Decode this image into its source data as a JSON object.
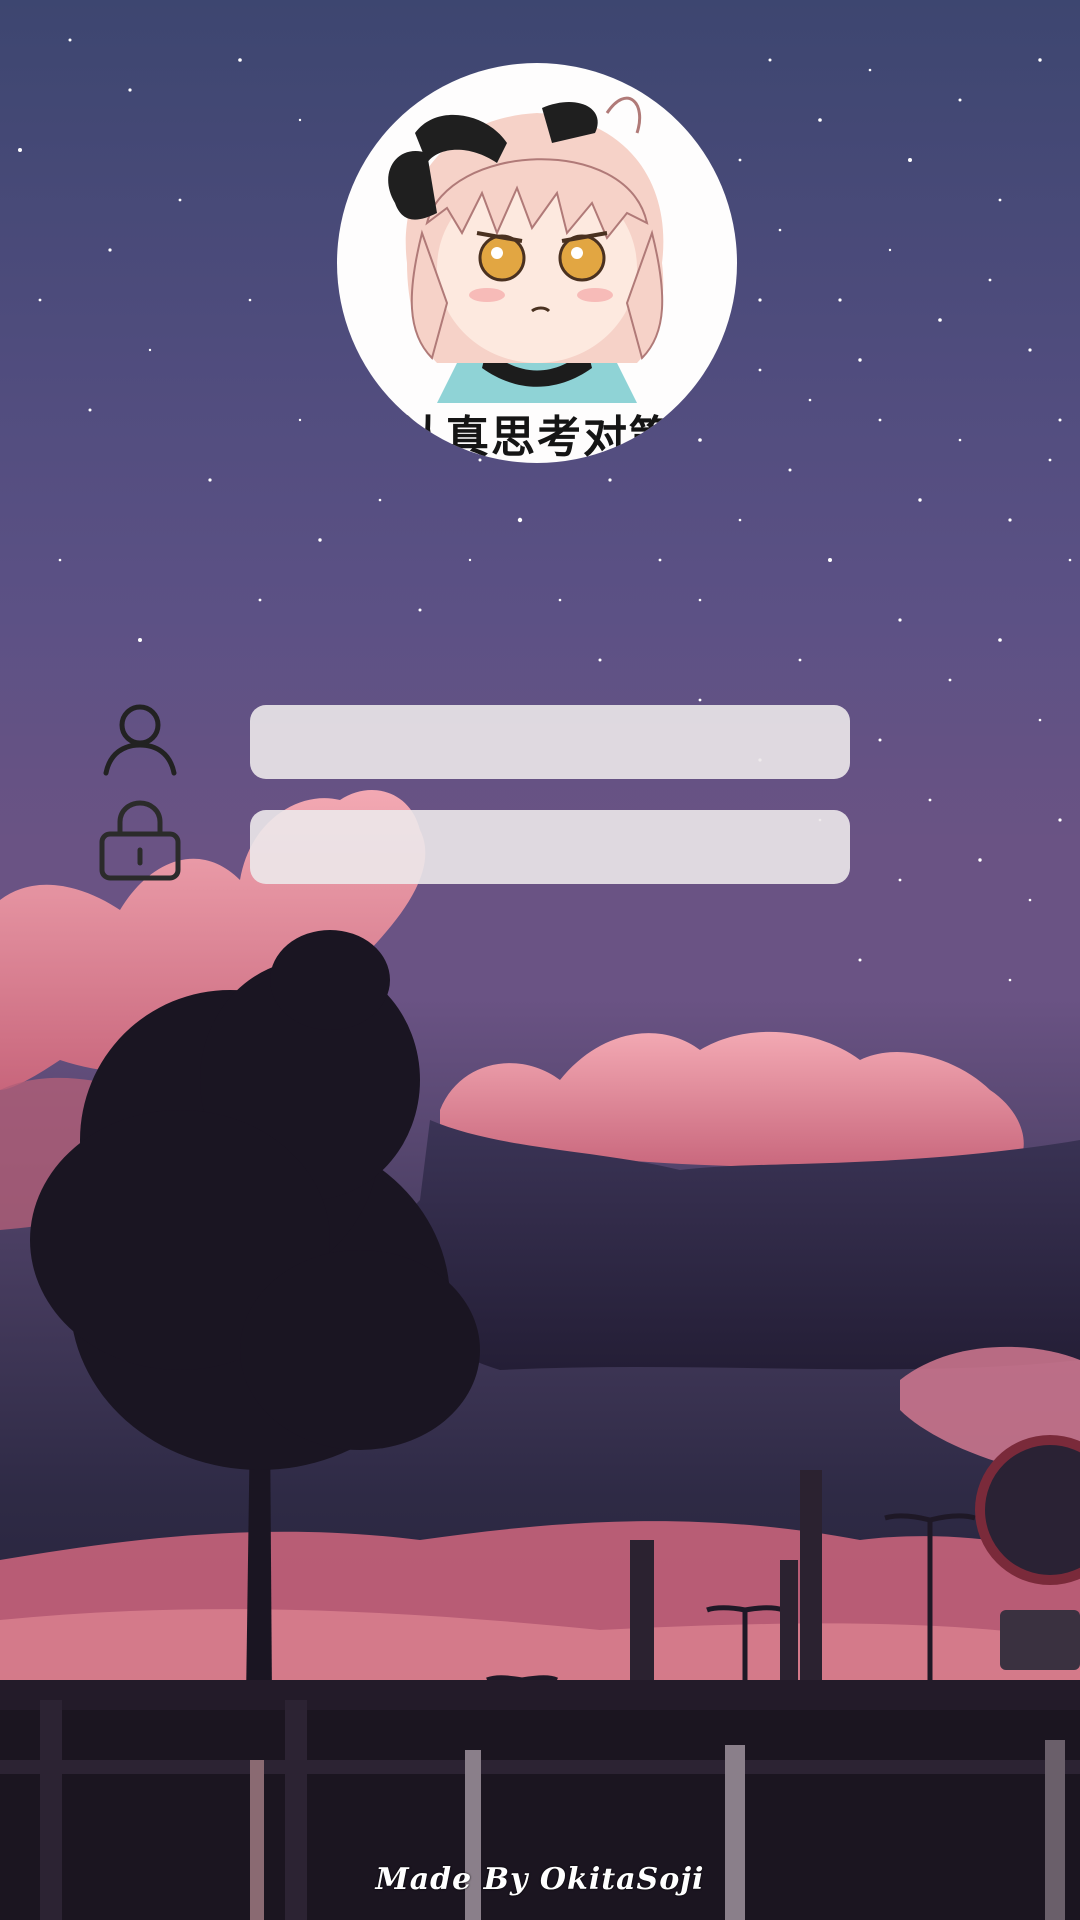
{
  "avatar": {
    "caption": "认真思考对策"
  },
  "login": {
    "username_icon": "user-icon",
    "password_icon": "lock-icon",
    "username_value": "",
    "password_value": ""
  },
  "footer": {
    "credit": "Made By OkitaSoji"
  },
  "colors": {
    "sky_top": "#3d4670",
    "sky_mid": "#6a5384",
    "cloud_pink": "#e3849a",
    "field_bg": "#ece8ea",
    "icon_stroke": "#222222"
  }
}
